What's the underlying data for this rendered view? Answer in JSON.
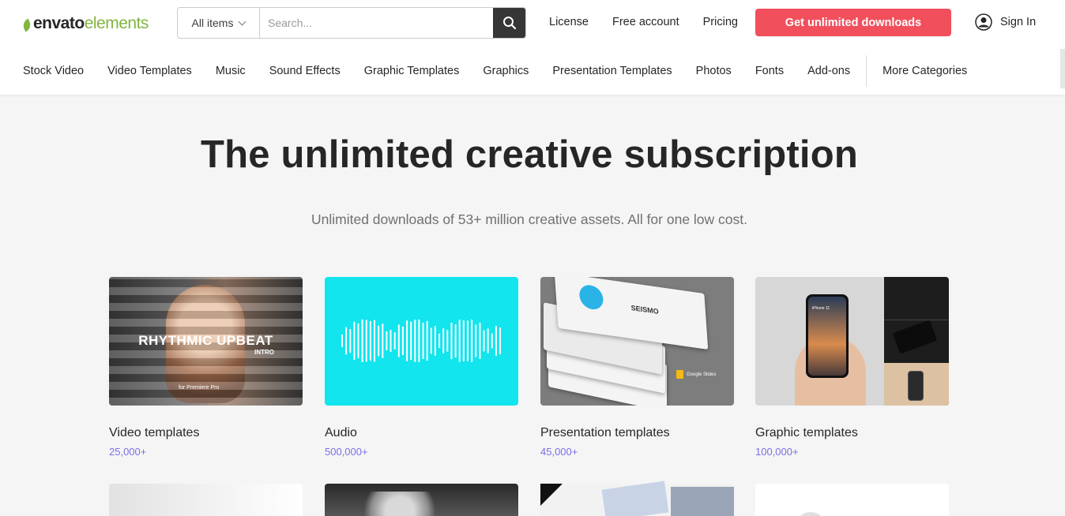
{
  "header": {
    "logo": {
      "brand_dark": "envato",
      "brand_green": "elements"
    },
    "search": {
      "filter_label": "All items",
      "placeholder": "Search..."
    },
    "links": [
      "License",
      "Free account",
      "Pricing"
    ],
    "cta_label": "Get unlimited downloads",
    "signin_label": "Sign In"
  },
  "categories": [
    "Stock Video",
    "Video Templates",
    "Music",
    "Sound Effects",
    "Graphic Templates",
    "Graphics",
    "Presentation Templates",
    "Photos",
    "Fonts",
    "Add-ons"
  ],
  "more_categories": "More Categories",
  "hero": {
    "title": "The unlimited creative subscription",
    "subtitle": "Unlimited downloads of 53+ million creative assets. All for one low cost."
  },
  "cards": [
    {
      "title": "Video templates",
      "count": "25,000+",
      "thumb_text": "RHYTHMIC UPBEAT",
      "thumb_sub": "INTRO",
      "thumb_foot": "for Premiere Pro"
    },
    {
      "title": "Audio",
      "count": "500,000+"
    },
    {
      "title": "Presentation templates",
      "count": "45,000+",
      "thumb_text": "SEISMO",
      "thumb_badge": "Google Slides"
    },
    {
      "title": "Graphic templates",
      "count": "100,000+",
      "thumb_text": "iPhone 11"
    }
  ],
  "colors": {
    "accent": "#f14f5c",
    "brand_green": "#82b541",
    "count_color": "#7a6ee8",
    "audio_bg": "#12e5ee"
  }
}
